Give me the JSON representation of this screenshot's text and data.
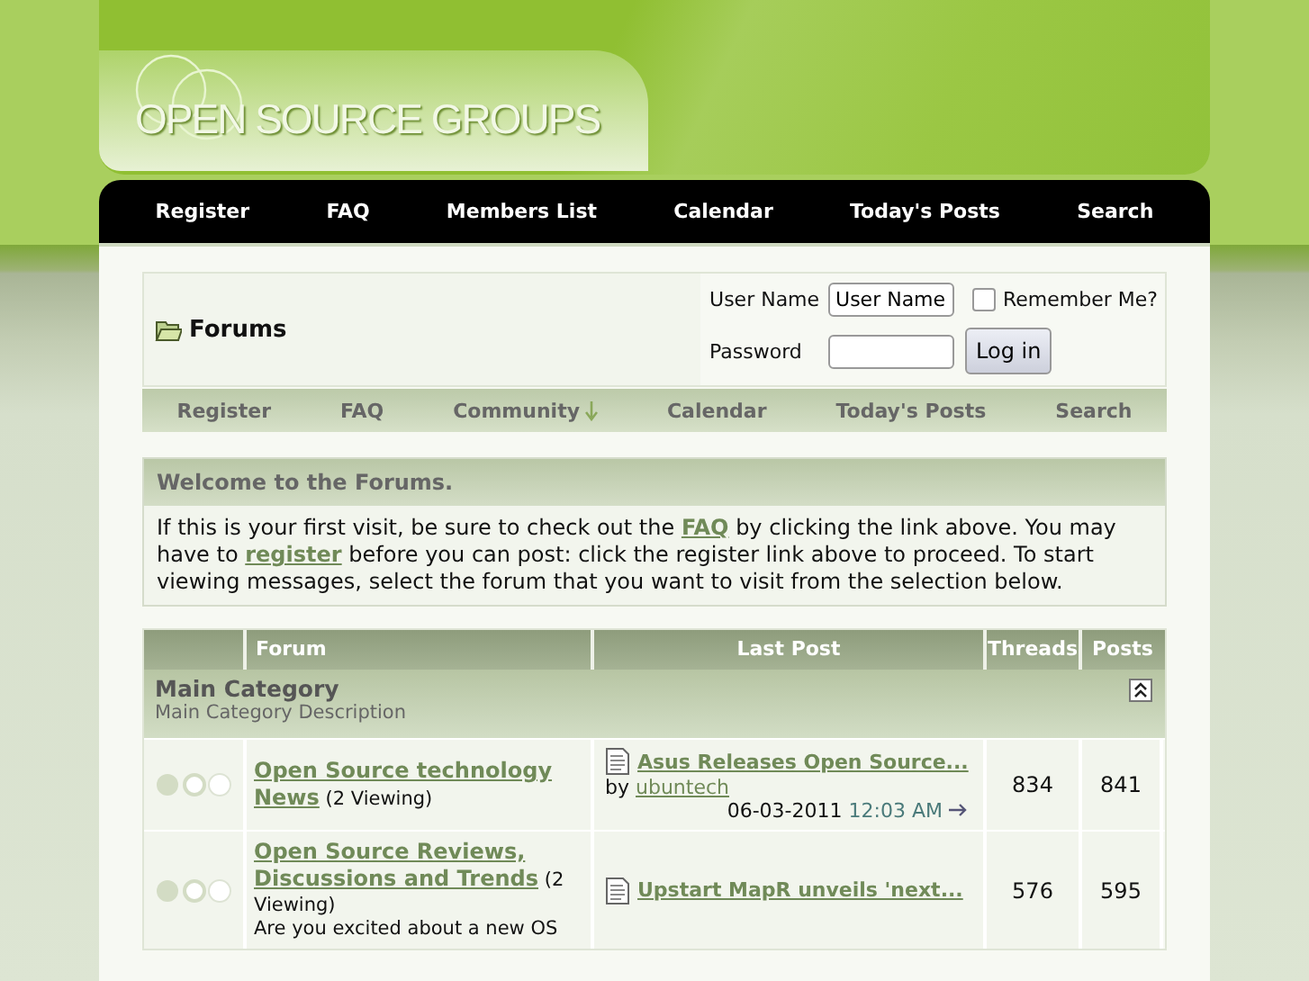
{
  "header": {
    "logo": "OPEN SOURCE GROUPS"
  },
  "nav": [
    "Register",
    "FAQ",
    "Members List",
    "Calendar",
    "Today's Posts",
    "Search"
  ],
  "breadcrumb": {
    "title": "Forums"
  },
  "login": {
    "username_label": "User Name",
    "username_value": "User Name",
    "remember_label": "Remember Me?",
    "remember_checked": false,
    "password_label": "Password",
    "button": "Log in"
  },
  "subnav": [
    {
      "label": "Register",
      "dropdown": false
    },
    {
      "label": "FAQ",
      "dropdown": false
    },
    {
      "label": "Community",
      "dropdown": true
    },
    {
      "label": "Calendar",
      "dropdown": false
    },
    {
      "label": "Today's Posts",
      "dropdown": false
    },
    {
      "label": "Search",
      "dropdown": false
    }
  ],
  "welcome": {
    "title": "Welcome to the Forums.",
    "parts": [
      {
        "kind": "text",
        "text": "If this is your first visit, be sure to check out the "
      },
      {
        "kind": "link",
        "text": "FAQ"
      },
      {
        "kind": "text",
        "text": " by clicking the link above. You may have to "
      },
      {
        "kind": "link",
        "text": "register"
      },
      {
        "kind": "text",
        "text": " before you can post: click the register link above to proceed. To start viewing messages, select the forum that you want to visit from the selection below."
      }
    ]
  },
  "forum_table": {
    "columns": [
      "Forum",
      "Last Post",
      "Threads",
      "Posts"
    ],
    "category": {
      "title": "Main Category",
      "description": "Main Category Description",
      "collapsed": false
    },
    "rows": [
      {
        "title": "Open Source technology News",
        "viewing": "(2 Viewing)",
        "last_post": {
          "title": "Asus Releases Open Source...",
          "by": "by",
          "author": "ubuntech",
          "date": "06-03-2011",
          "time": "12:03 AM"
        },
        "threads": "834",
        "posts": "841"
      },
      {
        "title": "Open Source Reviews, Discussions and Trends",
        "viewing": "(2 Viewing)",
        "description": "Are you excited about a new OS",
        "last_post": {
          "title": "Upstart MapR unveils 'next..."
        },
        "threads": "576",
        "posts": "595"
      }
    ]
  }
}
